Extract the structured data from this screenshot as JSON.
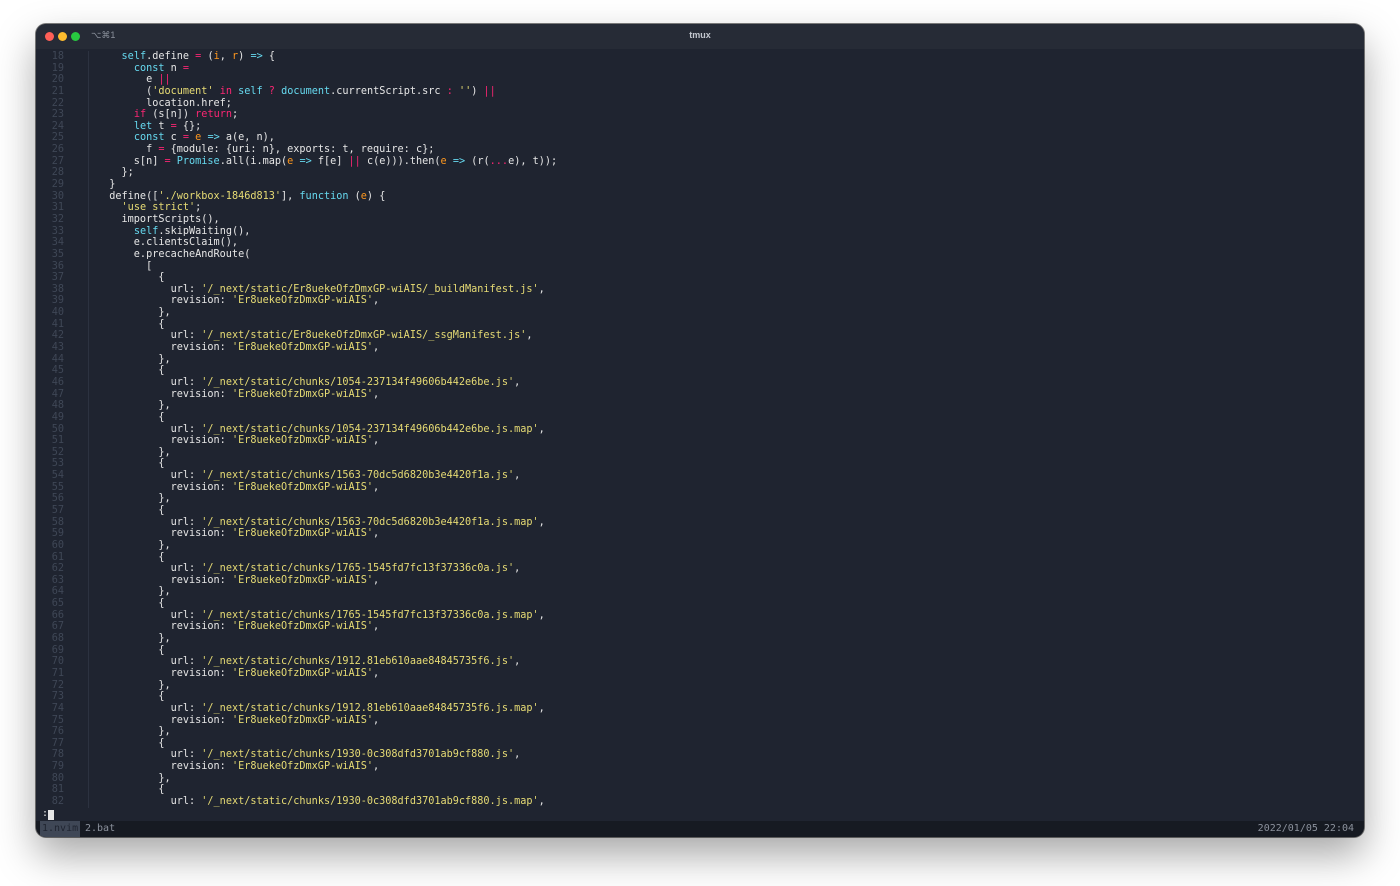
{
  "window": {
    "shortcut": "⌥⌘1",
    "title": "tmux"
  },
  "editor": {
    "lines": [
      {
        "num": "18",
        "tokens": [
          [
            "    ",
            "plain"
          ],
          [
            "self",
            "keyword"
          ],
          [
            ".define ",
            "plain"
          ],
          [
            "=",
            "operator"
          ],
          [
            " (",
            "plain"
          ],
          [
            "i",
            "param"
          ],
          [
            ", ",
            "plain"
          ],
          [
            "r",
            "param"
          ],
          [
            ") ",
            "plain"
          ],
          [
            "=>",
            "keyword"
          ],
          [
            " {",
            "plain"
          ]
        ]
      },
      {
        "num": "19",
        "tokens": [
          [
            "      ",
            "plain"
          ],
          [
            "const",
            "keyword"
          ],
          [
            " n ",
            "plain"
          ],
          [
            "=",
            "operator"
          ]
        ]
      },
      {
        "num": "20",
        "tokens": [
          [
            "        e ",
            "plain"
          ],
          [
            "||",
            "operator"
          ]
        ]
      },
      {
        "num": "21",
        "tokens": [
          [
            "        (",
            "plain"
          ],
          [
            "'document'",
            "string"
          ],
          [
            " ",
            "plain"
          ],
          [
            "in",
            "operator"
          ],
          [
            " ",
            "plain"
          ],
          [
            "self",
            "keyword"
          ],
          [
            " ",
            "plain"
          ],
          [
            "?",
            "operator"
          ],
          [
            " ",
            "plain"
          ],
          [
            "document",
            "builtin"
          ],
          [
            ".currentScript.src ",
            "plain"
          ],
          [
            ":",
            "operator"
          ],
          [
            " ",
            "plain"
          ],
          [
            "''",
            "string"
          ],
          [
            ") ",
            "plain"
          ],
          [
            "||",
            "operator"
          ]
        ]
      },
      {
        "num": "22",
        "tokens": [
          [
            "        location.href;",
            "plain"
          ]
        ]
      },
      {
        "num": "23",
        "tokens": [
          [
            "      ",
            "plain"
          ],
          [
            "if",
            "operator"
          ],
          [
            " (s[n]) ",
            "plain"
          ],
          [
            "return",
            "operator"
          ],
          [
            ";",
            "plain"
          ]
        ]
      },
      {
        "num": "24",
        "tokens": [
          [
            "      ",
            "plain"
          ],
          [
            "let",
            "keyword"
          ],
          [
            " t ",
            "plain"
          ],
          [
            "=",
            "operator"
          ],
          [
            " {};",
            "plain"
          ]
        ]
      },
      {
        "num": "25",
        "tokens": [
          [
            "      ",
            "plain"
          ],
          [
            "const",
            "keyword"
          ],
          [
            " c ",
            "plain"
          ],
          [
            "=",
            "operator"
          ],
          [
            " ",
            "plain"
          ],
          [
            "e",
            "param"
          ],
          [
            " ",
            "plain"
          ],
          [
            "=>",
            "keyword"
          ],
          [
            " a(e, n),",
            "plain"
          ]
        ]
      },
      {
        "num": "26",
        "tokens": [
          [
            "        f ",
            "plain"
          ],
          [
            "=",
            "operator"
          ],
          [
            " {module: {uri: n}, exports: t, require: c};",
            "plain"
          ]
        ]
      },
      {
        "num": "27",
        "tokens": [
          [
            "      s[n] ",
            "plain"
          ],
          [
            "=",
            "operator"
          ],
          [
            " ",
            "plain"
          ],
          [
            "Promise",
            "builtin"
          ],
          [
            ".all(i.map(",
            "plain"
          ],
          [
            "e",
            "param"
          ],
          [
            " ",
            "plain"
          ],
          [
            "=>",
            "keyword"
          ],
          [
            " f[e] ",
            "plain"
          ],
          [
            "||",
            "operator"
          ],
          [
            " c(e))).then(",
            "plain"
          ],
          [
            "e",
            "param"
          ],
          [
            " ",
            "plain"
          ],
          [
            "=>",
            "keyword"
          ],
          [
            " (r(",
            "plain"
          ],
          [
            "...",
            "operator"
          ],
          [
            "e), t));",
            "plain"
          ]
        ]
      },
      {
        "num": "28",
        "tokens": [
          [
            "    };",
            "plain"
          ]
        ]
      },
      {
        "num": "29",
        "tokens": [
          [
            "  }",
            "plain"
          ]
        ]
      },
      {
        "num": "30",
        "tokens": [
          [
            "  define([",
            "plain"
          ],
          [
            "'./workbox-1846d813'",
            "string"
          ],
          [
            "], ",
            "plain"
          ],
          [
            "function",
            "keyword"
          ],
          [
            " (",
            "plain"
          ],
          [
            "e",
            "param"
          ],
          [
            ") {",
            "plain"
          ]
        ]
      },
      {
        "num": "31",
        "tokens": [
          [
            "    ",
            "plain"
          ],
          [
            "'use strict'",
            "string"
          ],
          [
            ";",
            "plain"
          ]
        ]
      },
      {
        "num": "32",
        "tokens": [
          [
            "    importScripts(),",
            "plain"
          ]
        ]
      },
      {
        "num": "33",
        "tokens": [
          [
            "      ",
            "plain"
          ],
          [
            "self",
            "keyword"
          ],
          [
            ".skipWaiting(),",
            "plain"
          ]
        ]
      },
      {
        "num": "34",
        "tokens": [
          [
            "      e.clientsClaim(),",
            "plain"
          ]
        ]
      },
      {
        "num": "35",
        "tokens": [
          [
            "      e.precacheAndRoute(",
            "plain"
          ]
        ]
      },
      {
        "num": "36",
        "tokens": [
          [
            "        [",
            "plain"
          ]
        ]
      },
      {
        "num": "37",
        "tokens": [
          [
            "          {",
            "plain"
          ]
        ]
      },
      {
        "num": "38",
        "tokens": [
          [
            "            url: ",
            "plain"
          ],
          [
            "'/_next/static/Er8uekeOfzDmxGP-wiAIS/_buildManifest.js'",
            "string"
          ],
          [
            ",",
            "plain"
          ]
        ]
      },
      {
        "num": "39",
        "tokens": [
          [
            "            revision: ",
            "plain"
          ],
          [
            "'Er8uekeOfzDmxGP-wiAIS'",
            "string"
          ],
          [
            ",",
            "plain"
          ]
        ]
      },
      {
        "num": "40",
        "tokens": [
          [
            "          },",
            "plain"
          ]
        ]
      },
      {
        "num": "41",
        "tokens": [
          [
            "          {",
            "plain"
          ]
        ]
      },
      {
        "num": "42",
        "tokens": [
          [
            "            url: ",
            "plain"
          ],
          [
            "'/_next/static/Er8uekeOfzDmxGP-wiAIS/_ssgManifest.js'",
            "string"
          ],
          [
            ",",
            "plain"
          ]
        ]
      },
      {
        "num": "43",
        "tokens": [
          [
            "            revision: ",
            "plain"
          ],
          [
            "'Er8uekeOfzDmxGP-wiAIS'",
            "string"
          ],
          [
            ",",
            "plain"
          ]
        ]
      },
      {
        "num": "44",
        "tokens": [
          [
            "          },",
            "plain"
          ]
        ]
      },
      {
        "num": "45",
        "tokens": [
          [
            "          {",
            "plain"
          ]
        ]
      },
      {
        "num": "46",
        "tokens": [
          [
            "            url: ",
            "plain"
          ],
          [
            "'/_next/static/chunks/1054-237134f49606b442e6be.js'",
            "string"
          ],
          [
            ",",
            "plain"
          ]
        ]
      },
      {
        "num": "47",
        "tokens": [
          [
            "            revision: ",
            "plain"
          ],
          [
            "'Er8uekeOfzDmxGP-wiAIS'",
            "string"
          ],
          [
            ",",
            "plain"
          ]
        ]
      },
      {
        "num": "48",
        "tokens": [
          [
            "          },",
            "plain"
          ]
        ]
      },
      {
        "num": "49",
        "tokens": [
          [
            "          {",
            "plain"
          ]
        ]
      },
      {
        "num": "50",
        "tokens": [
          [
            "            url: ",
            "plain"
          ],
          [
            "'/_next/static/chunks/1054-237134f49606b442e6be.js.map'",
            "string"
          ],
          [
            ",",
            "plain"
          ]
        ]
      },
      {
        "num": "51",
        "tokens": [
          [
            "            revision: ",
            "plain"
          ],
          [
            "'Er8uekeOfzDmxGP-wiAIS'",
            "string"
          ],
          [
            ",",
            "plain"
          ]
        ]
      },
      {
        "num": "52",
        "tokens": [
          [
            "          },",
            "plain"
          ]
        ]
      },
      {
        "num": "53",
        "tokens": [
          [
            "          {",
            "plain"
          ]
        ]
      },
      {
        "num": "54",
        "tokens": [
          [
            "            url: ",
            "plain"
          ],
          [
            "'/_next/static/chunks/1563-70dc5d6820b3e4420f1a.js'",
            "string"
          ],
          [
            ",",
            "plain"
          ]
        ]
      },
      {
        "num": "55",
        "tokens": [
          [
            "            revision: ",
            "plain"
          ],
          [
            "'Er8uekeOfzDmxGP-wiAIS'",
            "string"
          ],
          [
            ",",
            "plain"
          ]
        ]
      },
      {
        "num": "56",
        "tokens": [
          [
            "          },",
            "plain"
          ]
        ]
      },
      {
        "num": "57",
        "tokens": [
          [
            "          {",
            "plain"
          ]
        ]
      },
      {
        "num": "58",
        "tokens": [
          [
            "            url: ",
            "plain"
          ],
          [
            "'/_next/static/chunks/1563-70dc5d6820b3e4420f1a.js.map'",
            "string"
          ],
          [
            ",",
            "plain"
          ]
        ]
      },
      {
        "num": "59",
        "tokens": [
          [
            "            revision: ",
            "plain"
          ],
          [
            "'Er8uekeOfzDmxGP-wiAIS'",
            "string"
          ],
          [
            ",",
            "plain"
          ]
        ]
      },
      {
        "num": "60",
        "tokens": [
          [
            "          },",
            "plain"
          ]
        ]
      },
      {
        "num": "61",
        "tokens": [
          [
            "          {",
            "plain"
          ]
        ]
      },
      {
        "num": "62",
        "tokens": [
          [
            "            url: ",
            "plain"
          ],
          [
            "'/_next/static/chunks/1765-1545fd7fc13f37336c0a.js'",
            "string"
          ],
          [
            ",",
            "plain"
          ]
        ]
      },
      {
        "num": "63",
        "tokens": [
          [
            "            revision: ",
            "plain"
          ],
          [
            "'Er8uekeOfzDmxGP-wiAIS'",
            "string"
          ],
          [
            ",",
            "plain"
          ]
        ]
      },
      {
        "num": "64",
        "tokens": [
          [
            "          },",
            "plain"
          ]
        ]
      },
      {
        "num": "65",
        "tokens": [
          [
            "          {",
            "plain"
          ]
        ]
      },
      {
        "num": "66",
        "tokens": [
          [
            "            url: ",
            "plain"
          ],
          [
            "'/_next/static/chunks/1765-1545fd7fc13f37336c0a.js.map'",
            "string"
          ],
          [
            ",",
            "plain"
          ]
        ]
      },
      {
        "num": "67",
        "tokens": [
          [
            "            revision: ",
            "plain"
          ],
          [
            "'Er8uekeOfzDmxGP-wiAIS'",
            "string"
          ],
          [
            ",",
            "plain"
          ]
        ]
      },
      {
        "num": "68",
        "tokens": [
          [
            "          },",
            "plain"
          ]
        ]
      },
      {
        "num": "69",
        "tokens": [
          [
            "          {",
            "plain"
          ]
        ]
      },
      {
        "num": "70",
        "tokens": [
          [
            "            url: ",
            "plain"
          ],
          [
            "'/_next/static/chunks/1912.81eb610aae84845735f6.js'",
            "string"
          ],
          [
            ",",
            "plain"
          ]
        ]
      },
      {
        "num": "71",
        "tokens": [
          [
            "            revision: ",
            "plain"
          ],
          [
            "'Er8uekeOfzDmxGP-wiAIS'",
            "string"
          ],
          [
            ",",
            "plain"
          ]
        ]
      },
      {
        "num": "72",
        "tokens": [
          [
            "          },",
            "plain"
          ]
        ]
      },
      {
        "num": "73",
        "tokens": [
          [
            "          {",
            "plain"
          ]
        ]
      },
      {
        "num": "74",
        "tokens": [
          [
            "            url: ",
            "plain"
          ],
          [
            "'/_next/static/chunks/1912.81eb610aae84845735f6.js.map'",
            "string"
          ],
          [
            ",",
            "plain"
          ]
        ]
      },
      {
        "num": "75",
        "tokens": [
          [
            "            revision: ",
            "plain"
          ],
          [
            "'Er8uekeOfzDmxGP-wiAIS'",
            "string"
          ],
          [
            ",",
            "plain"
          ]
        ]
      },
      {
        "num": "76",
        "tokens": [
          [
            "          },",
            "plain"
          ]
        ]
      },
      {
        "num": "77",
        "tokens": [
          [
            "          {",
            "plain"
          ]
        ]
      },
      {
        "num": "78",
        "tokens": [
          [
            "            url: ",
            "plain"
          ],
          [
            "'/_next/static/chunks/1930-0c308dfd3701ab9cf880.js'",
            "string"
          ],
          [
            ",",
            "plain"
          ]
        ]
      },
      {
        "num": "79",
        "tokens": [
          [
            "            revision: ",
            "plain"
          ],
          [
            "'Er8uekeOfzDmxGP-wiAIS'",
            "string"
          ],
          [
            ",",
            "plain"
          ]
        ]
      },
      {
        "num": "80",
        "tokens": [
          [
            "          },",
            "plain"
          ]
        ]
      },
      {
        "num": "81",
        "tokens": [
          [
            "          {",
            "plain"
          ]
        ]
      },
      {
        "num": "82",
        "tokens": [
          [
            "            url: ",
            "plain"
          ],
          [
            "'/_next/static/chunks/1930-0c308dfd3701ab9cf880.js.map'",
            "string"
          ],
          [
            ",",
            "plain"
          ]
        ]
      }
    ]
  },
  "cmdline": {
    "prompt": ":"
  },
  "statusbar": {
    "tab_active": "1.nvim",
    "tab_inactive": "2.bat",
    "clock": "2022/01/05 22:04"
  },
  "colors": {
    "background": "#1f2430",
    "keyword": "#66d9ef",
    "operator": "#f92672",
    "string": "#e6db74",
    "param": "#fd971f",
    "plain": "#e6e6e6",
    "line_number": "#3f4756"
  }
}
